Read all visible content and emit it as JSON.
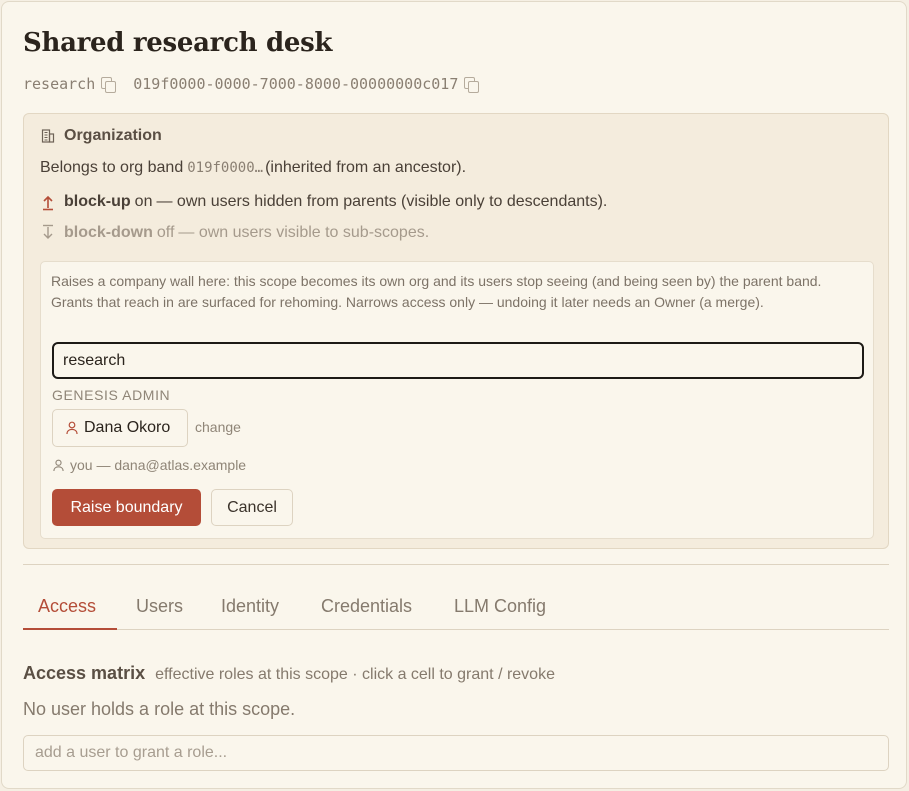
{
  "header": {
    "title": "Shared research desk",
    "slug": "research",
    "scope_id": "019f0000-0000-7000-8000-00000000c017"
  },
  "organization": {
    "heading": "Organization",
    "band_prefix": "Belongs to org band",
    "band_id": "019f0000…",
    "band_suffix": "(inherited from an ancestor).",
    "block_up": {
      "name": "block-up",
      "state": "on",
      "text": "— own users hidden from parents (visible only to descendants)."
    },
    "block_down": {
      "name": "block-down",
      "state": "off",
      "text": "— own users visible to sub-scopes."
    }
  },
  "raise": {
    "description": "Raises a company wall here: this scope becomes its own org and its users stop seeing (and being seen by) the parent band. Grants that reach in are surfaced for rehoming. Narrows access only — undoing it later needs an Owner (a merge).",
    "name_value": "research",
    "genesis_label": "GENESIS ADMIN",
    "admin_name": "Dana Okoro",
    "change_label": "change",
    "you_text": "you — dana@atlas.example",
    "raise_button": "Raise boundary",
    "cancel_button": "Cancel"
  },
  "tabs": [
    {
      "label": "Access",
      "active": true
    },
    {
      "label": "Users",
      "active": false
    },
    {
      "label": "Identity",
      "active": false
    },
    {
      "label": "Credentials",
      "active": false
    },
    {
      "label": "LLM Config",
      "active": false
    }
  ],
  "access": {
    "title": "Access matrix",
    "subtitle": "effective roles at this scope · click a cell to grant / revoke",
    "empty": "No user holds a role at this scope.",
    "add_placeholder": "add a user to grant a role..."
  },
  "colors": {
    "accent": "#b44d38",
    "background": "#faf6ec",
    "card": "#f4ecdd"
  }
}
